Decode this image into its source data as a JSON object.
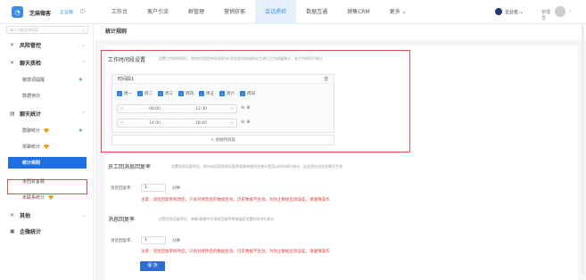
{
  "header": {
    "brand": "芝麻微客",
    "brand_tag": "企业版",
    "nav": [
      "工作台",
      "客户引流",
      "群管理",
      "营销获客",
      "会话质检",
      "数据互通",
      "销售CRM",
      "更多 ⌄"
    ],
    "active_nav_index": 4,
    "company": "企业名 ⌄",
    "user_name": "管理员"
  },
  "sidebar": {
    "search_placeholder": "输入功能名称搜索",
    "groups": [
      {
        "label": "风险管控",
        "icon": "shield-icon"
      },
      {
        "label": "聊天质检",
        "icon": "check-icon"
      },
      {
        "label": "聊天统计",
        "icon": "stats-icon"
      },
      {
        "label": "其他",
        "icon": "more-icon"
      },
      {
        "label": "企微统计",
        "icon": "report-icon"
      }
    ],
    "items": [
      "敏感词提醒",
      "数据待办",
      "群聊统计",
      "单聊统计",
      "统计规则",
      "未回复客服",
      "未联系统计"
    ]
  },
  "main": {
    "page_title": "统计规则",
    "section1": {
      "title": "工作时间段设置",
      "desc": "设置工作时间段后，则仅对设定的时间段内对开启会话存档的员工进行工作质量统计，非工作时间不统计"
    },
    "period": {
      "name": "时间段1",
      "days": [
        "周一",
        "周二",
        "周三",
        "周四",
        "周五",
        "周六",
        "周日"
      ],
      "rows": [
        {
          "start": "08:00",
          "end": "12:30"
        },
        {
          "start": "14:00",
          "end": "18:00"
        }
      ],
      "separator": "-",
      "add_label": "+ 添加时间段"
    },
    "section2": {
      "title": "员工回消息回复率",
      "desc": "设置消息回复率后，群内成员回消息回复率和接单超时会统计是否以时间进行统计，这这里仅对全员模式生效",
      "field_label": "消息回复率：",
      "value": "1",
      "unit": "分钟",
      "hint": "注意：消息回复率修改后，只会对修改后的数据生效，历史数据不生效，为防止数据出现误差，请谨慎操作"
    },
    "section3": {
      "title": "消息回复率",
      "desc": "设置消息回复率后，单聊/群聊中对消息回复率将根据此设置时间进行统计",
      "field_label": "消息回复率：",
      "value": "1",
      "unit": "分钟",
      "hint": "注意：消息回复率修改后，只会对修改后的数据生效，历史数据不生效，为防止数据出现误差，请谨慎操作"
    },
    "save_label": "保 存"
  },
  "colors": {
    "accent": "#2b7de0",
    "highlight_border": "#e05050",
    "hint": "#e04040",
    "gem": "#f0a020"
  }
}
